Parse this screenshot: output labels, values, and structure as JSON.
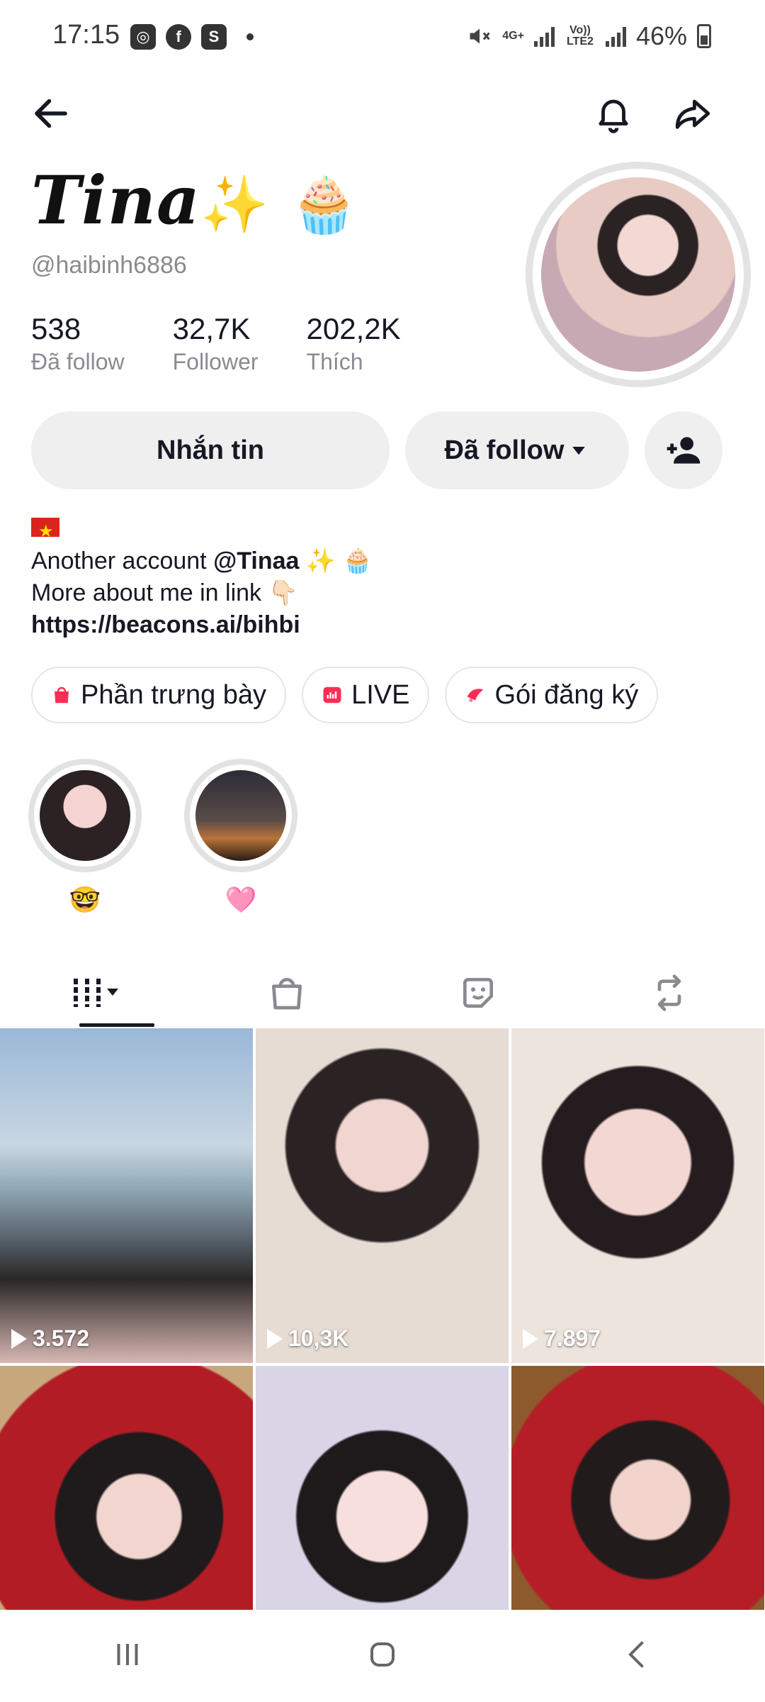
{
  "status_bar": {
    "time": "17:15",
    "network_top": "4G+",
    "network_lte": "Vo)) LTE2",
    "battery": "46%"
  },
  "profile": {
    "display_name": "Tina",
    "name_emojis": "✨ 🧁",
    "username": "@haibinh6886",
    "stats": [
      {
        "value": "538",
        "label": "Đã follow"
      },
      {
        "value": "32,7K",
        "label": "Follower"
      },
      {
        "value": "202,2K",
        "label": "Thích"
      }
    ]
  },
  "actions": {
    "message_label": "Nhắn tin",
    "following_label": "Đã follow"
  },
  "bio": {
    "line1_prefix": "Another account ",
    "line1_mention": "@Tinaa",
    "line1_suffix": " ✨ 🧁",
    "line2": "More about me in link 👇🏻",
    "link": "https://beacons.ai/bihbi"
  },
  "chips": [
    {
      "label": "Phần trưng bày",
      "icon": "shop-bag-icon",
      "color": "#fe2c55"
    },
    {
      "label": "LIVE",
      "icon": "live-icon",
      "color": "#fe2c55"
    },
    {
      "label": "Gói đăng ký",
      "icon": "subscription-icon",
      "color": "#fe2c55"
    }
  ],
  "highlights": [
    {
      "emoji": "🤓"
    },
    {
      "emoji": "🩷"
    }
  ],
  "tabs": [
    "videos-grid-icon",
    "shop-icon",
    "favorites-icon",
    "reposts-icon"
  ],
  "videos": [
    {
      "views": "3.572"
    },
    {
      "views": "10,3K"
    },
    {
      "views": "7.897"
    },
    {
      "views": ""
    },
    {
      "views": ""
    },
    {
      "views": ""
    }
  ]
}
